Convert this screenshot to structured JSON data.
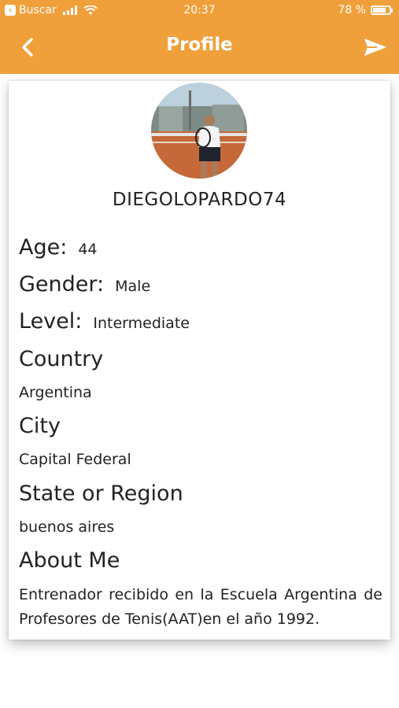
{
  "status_bar": {
    "back_app": "Buscar",
    "time": "20:37",
    "battery": "78 %",
    "battery_level": 0.78
  },
  "header": {
    "title": "Profile"
  },
  "profile": {
    "username": "DIEGOLOPARDO74",
    "age_label": "Age:",
    "age_value": "44",
    "gender_label": "Gender:",
    "gender_value": "Male",
    "level_label": "Level:",
    "level_value": "Intermediate",
    "country_label": "Country",
    "country_value": "Argentina",
    "city_label": "City",
    "city_value": "Capital Federal",
    "state_label": "State or Region",
    "state_value": "buenos aires",
    "about_label": "About Me",
    "about_value": "Entrenador recibido en la Escuela Argentina de Profesores de Tenis(AAT)en el año 1992."
  },
  "colors": {
    "accent": "#f0a03a",
    "text": "#222222"
  },
  "icons": [
    "back-chevron-icon",
    "send-icon",
    "wifi-icon",
    "signal-icon",
    "battery-icon"
  ]
}
